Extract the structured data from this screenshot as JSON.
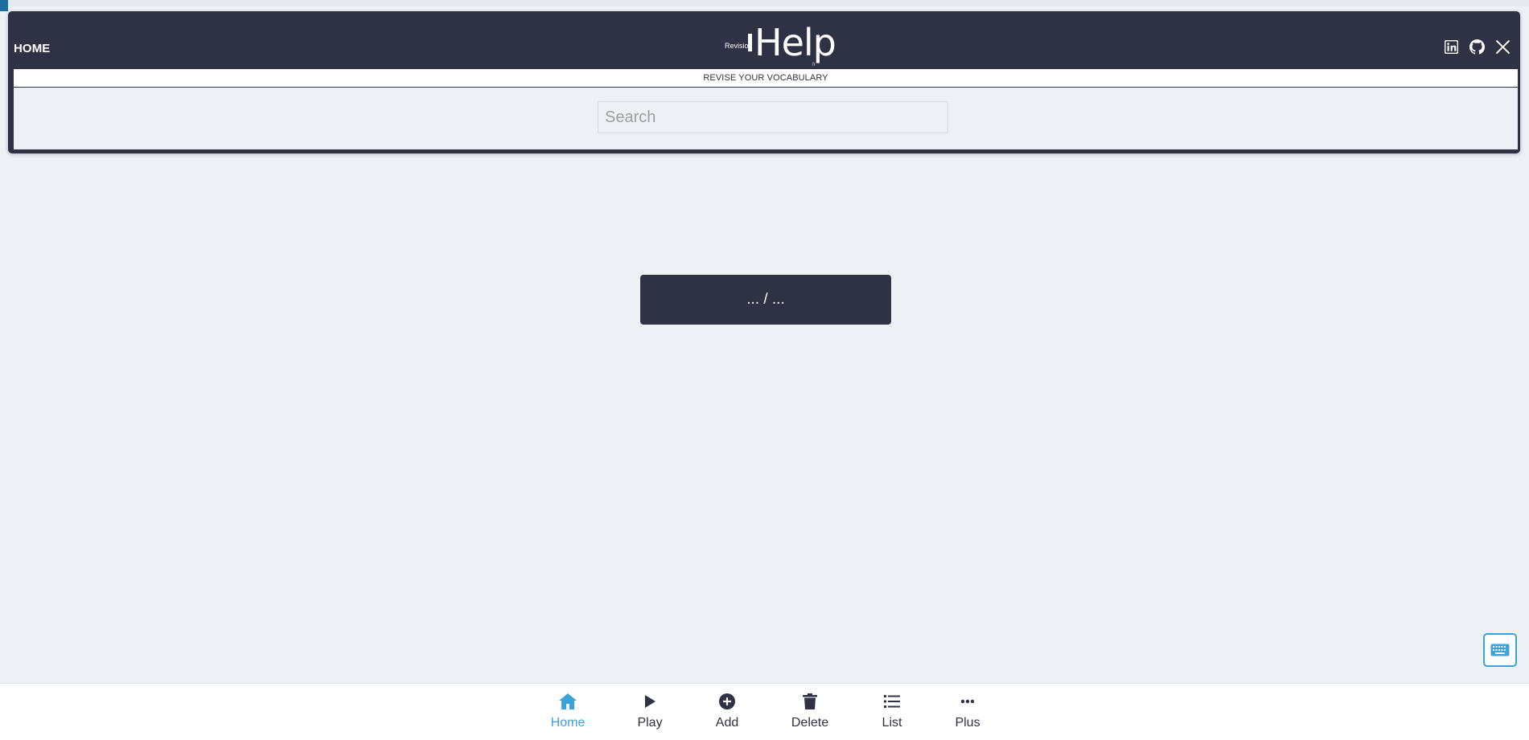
{
  "header": {
    "home_label": "HOME",
    "logo_small": "Revision",
    "logo_big": "Help",
    "logo_tiny": "fr",
    "subtitle": "REVISE YOUR VOCABULARY",
    "social": [
      {
        "name": "linkedin-icon"
      },
      {
        "name": "github-icon"
      },
      {
        "name": "x-icon"
      }
    ]
  },
  "search": {
    "placeholder": "Search",
    "value": ""
  },
  "counter": {
    "text": "... / ..."
  },
  "bottom_nav": {
    "items": [
      {
        "label": "Home",
        "icon": "home-icon",
        "active": true
      },
      {
        "label": "Play",
        "icon": "play-icon",
        "active": false
      },
      {
        "label": "Add",
        "icon": "add-icon",
        "active": false
      },
      {
        "label": "Delete",
        "icon": "trash-icon",
        "active": false
      },
      {
        "label": "List",
        "icon": "list-icon",
        "active": false
      },
      {
        "label": "Plus",
        "icon": "more-icon",
        "active": false
      }
    ]
  },
  "colors": {
    "primary": "#2f3144",
    "accent": "#3aa3d8",
    "background": "#edf1f5"
  }
}
